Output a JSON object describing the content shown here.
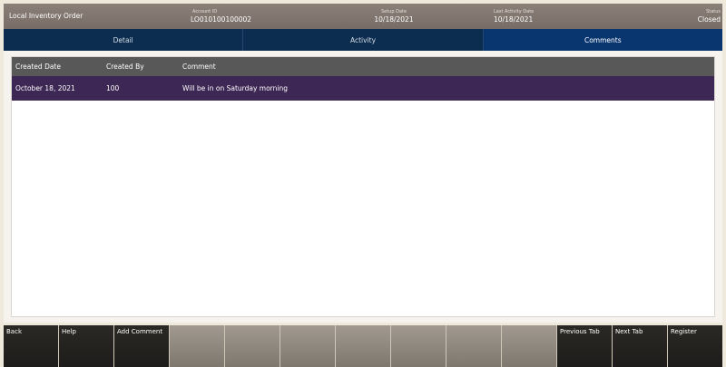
{
  "header": {
    "title": "Local Inventory Order",
    "account_id_label": "Account ID",
    "account_id_value": "LO010100100002",
    "setup_date_label": "Setup Date",
    "setup_date_value": "10/18/2021",
    "last_activity_label": "Last Activity Date",
    "last_activity_value": "10/18/2021",
    "status_label": "Status",
    "status_value": "Closed"
  },
  "tabs": [
    {
      "label": "Detail",
      "active": false
    },
    {
      "label": "Activity",
      "active": false
    },
    {
      "label": "Comments",
      "active": true
    }
  ],
  "table": {
    "columns": [
      "Created Date",
      "Created By",
      "Comment"
    ],
    "rows": [
      [
        "October 18, 2021",
        "100",
        "Will be in on Saturday morning"
      ]
    ]
  },
  "footer": {
    "keys": [
      "Back",
      "Help",
      "Add Comment",
      "",
      "",
      "",
      "",
      "",
      "",
      "",
      "Previous Tab",
      "Next Tab",
      "Register"
    ]
  },
  "colors": {
    "header_bg": "#7f756e",
    "tab_bg": "#0c2d50",
    "tab_active_bg": "#0a3670",
    "table_header_bg": "#585858",
    "selected_row_bg": "#3d2754",
    "page_bg": "#efe9dc"
  }
}
